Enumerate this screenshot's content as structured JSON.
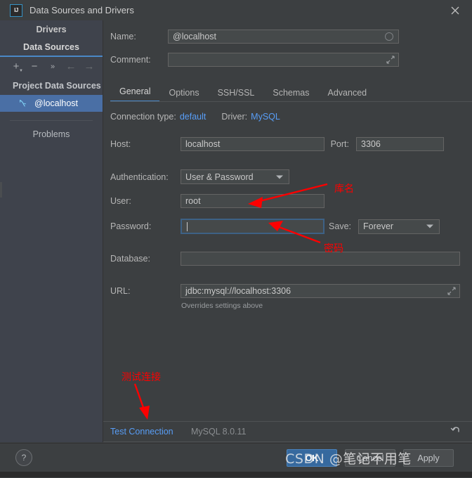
{
  "window": {
    "title": "Data Sources and Drivers",
    "app_icon": "intellij-idea-icon",
    "close_icon": "close-icon"
  },
  "sidebar": {
    "tabs": [
      {
        "label": "Drivers",
        "active": false
      },
      {
        "label": "Data Sources",
        "active": true
      }
    ],
    "toolbar": [
      {
        "name": "add-button",
        "glyph": "+"
      },
      {
        "name": "remove-button",
        "glyph": "−"
      },
      {
        "name": "more-button",
        "glyph": "»"
      },
      {
        "name": "back-button",
        "glyph": "←"
      },
      {
        "name": "forward-button",
        "glyph": "→"
      }
    ],
    "group_title": "Project Data Sources",
    "items": [
      {
        "label": "@localhost",
        "icon": "mysql-dolphin-icon",
        "selected": true
      }
    ],
    "problems_label": "Problems"
  },
  "main": {
    "name_label": "Name:",
    "name_value": "@localhost",
    "comment_label": "Comment:",
    "comment_value": "",
    "comment_placeholder": "",
    "tabs": [
      {
        "label": "General",
        "active": true
      },
      {
        "label": "Options",
        "active": false
      },
      {
        "label": "SSH/SSL",
        "active": false
      },
      {
        "label": "Schemas",
        "active": false
      },
      {
        "label": "Advanced",
        "active": false
      }
    ],
    "connection_type_label": "Connection type:",
    "connection_type_value": "default",
    "driver_label": "Driver:",
    "driver_value": "MySQL",
    "host_label": "Host:",
    "host_value": "localhost",
    "port_label": "Port:",
    "port_value": "3306",
    "authentication_label": "Authentication:",
    "authentication_value": "User & Password",
    "user_label": "User:",
    "user_value": "root",
    "password_label": "Password:",
    "password_value": "",
    "save_label": "Save:",
    "save_value": "Forever",
    "database_label": "Database:",
    "database_value": "",
    "url_label": "URL:",
    "url_value": "jdbc:mysql://localhost:3306",
    "url_hint": "Overrides settings above",
    "test_connection_label": "Test Connection",
    "driver_version": "MySQL 8.0.11",
    "revert_icon": "revert-arrow-icon"
  },
  "footer": {
    "help_label": "?",
    "ok_label": "OK",
    "cancel_label": "Cancel",
    "apply_label": "Apply"
  },
  "annotations": {
    "database_note": "库名",
    "password_note": "密码",
    "test_note": "测试连接",
    "watermark": "CSDN @笔记不用笔",
    "color": "#fd0000"
  },
  "colors": {
    "accent_blue": "#4a88c7",
    "link_blue": "#589df6",
    "selection_blue": "#4a6fa5",
    "panel_bg": "#3c3f41",
    "sidebar_bg": "#3f434c",
    "primary_button": "#36699e",
    "annotation_red": "#fd0000"
  }
}
